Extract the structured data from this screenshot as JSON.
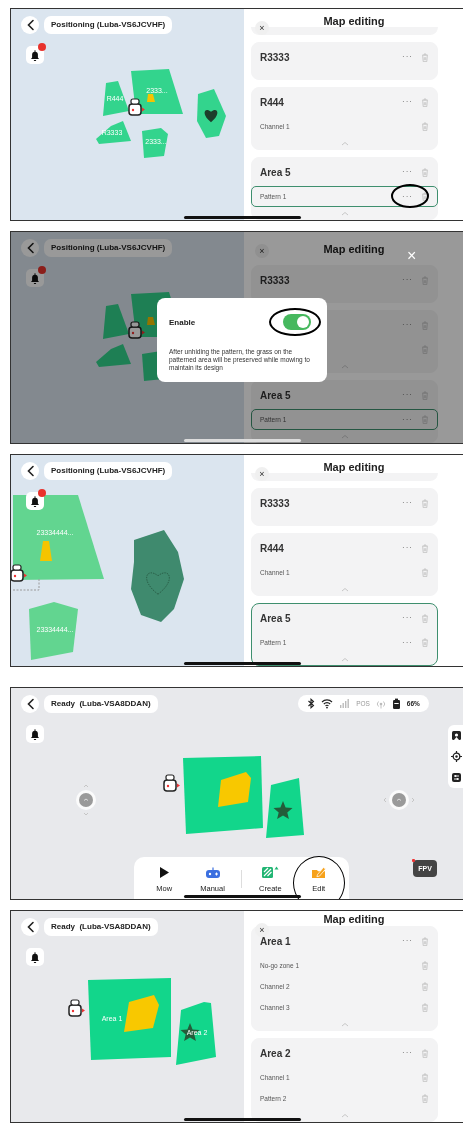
{
  "screens": [
    {
      "kind": "editing",
      "dimmed": false,
      "header": {
        "title": "Positioning (Luba-VS6JCVHF)"
      },
      "bell": {
        "badge": true
      },
      "map": {
        "kind": "scattered",
        "labels": [
          "R444",
          "2333...",
          "R3333",
          "2333..."
        ]
      },
      "panel": {
        "close": "×",
        "title": "Map editing",
        "groups": [
          {
            "selected": false
          },
          {
            "title": "R3333",
            "more": "···",
            "selected": false
          },
          {
            "title": "R444",
            "more": "···",
            "selected": false,
            "rows": [
              {
                "label": "Channel 1",
                "selected": false
              }
            ]
          },
          {
            "title": "Area 5",
            "more": "···",
            "selected": false,
            "rows": [
              {
                "label": "Pattern 1",
                "more": "···",
                "selected": true,
                "circled": true
              }
            ]
          }
        ]
      }
    },
    {
      "kind": "editing",
      "dimmed": true,
      "header": {
        "title": "Positioning (Luba-VS6JCVHF)"
      },
      "bell": {
        "badge": true
      },
      "map": {
        "kind": "scattered"
      },
      "panel": {
        "close": "×",
        "title": "Map editing",
        "groups": [
          {
            "title": "R3333",
            "more": "···",
            "selected": false
          },
          {
            "more": "···",
            "selected": false,
            "rows": [
              {
                "selected": false
              }
            ]
          },
          {
            "title": "Area 5",
            "more": "···",
            "selected": false,
            "rows": [
              {
                "label": "Pattern 1",
                "more": "···",
                "selected": true
              }
            ]
          }
        ]
      },
      "dialog": {
        "label": "Enable",
        "on": true,
        "circled": true,
        "text": "After unhiding the pattern, the grass on the patterned area will be preserved while mowing to maintain its design",
        "close": "×"
      }
    },
    {
      "kind": "editing",
      "dimmed": false,
      "header": {
        "title": "Positioning (Luba-VS6JCVHF)"
      },
      "bell": {
        "badge": true
      },
      "map": {
        "kind": "zoomed",
        "labels": [
          "23334444...",
          "23334444..."
        ]
      },
      "panel": {
        "close": "×",
        "title": "Map editing",
        "groups": [
          {
            "selected": false
          },
          {
            "title": "R3333",
            "more": "···",
            "selected": false
          },
          {
            "title": "R444",
            "more": "···",
            "selected": false,
            "rows": [
              {
                "label": "Channel 1",
                "selected": false
              }
            ]
          },
          {
            "title": "Area 5",
            "more": "···",
            "selected": true,
            "rows": [
              {
                "label": "Pattern 1",
                "more": "···",
                "selected": false
              }
            ]
          }
        ]
      }
    },
    {
      "kind": "home",
      "dimmed": false,
      "header": {
        "title": "Ready  (Luba-VSA8DDAN)"
      },
      "bell": {
        "badge": false
      },
      "map": {
        "kind": "pair"
      },
      "status": {
        "pos": "POS",
        "battery": "66%"
      },
      "toolbar": [
        {
          "kind": "mow",
          "label": "Mow"
        },
        {
          "kind": "manual",
          "label": "Manual"
        },
        {
          "kind": "create",
          "label": "Create"
        },
        {
          "kind": "edit",
          "label": "Edit",
          "circled": true
        }
      ],
      "fpv": "FPV"
    },
    {
      "kind": "editing",
      "dimmed": false,
      "header": {
        "title": "Ready  (Luba-VSA8DDAN)"
      },
      "bell": {
        "badge": false
      },
      "map": {
        "kind": "pair-compact",
        "labels": [
          "Area 1",
          "Area 2"
        ]
      },
      "panel": {
        "close": "×",
        "title": "Map editing",
        "groups": [
          {
            "title": "Area 1",
            "more": "···",
            "selected": false,
            "rows": [
              {
                "label": "No-go zone 1",
                "selected": false
              },
              {
                "label": "Channel 2",
                "selected": false
              },
              {
                "label": "Channel 3",
                "selected": false
              }
            ]
          },
          {
            "title": "Area 2",
            "more": "···",
            "selected": false,
            "rows": [
              {
                "label": "Channel 1",
                "selected": false
              },
              {
                "label": "Pattern 2",
                "selected": false
              }
            ]
          }
        ]
      }
    }
  ]
}
